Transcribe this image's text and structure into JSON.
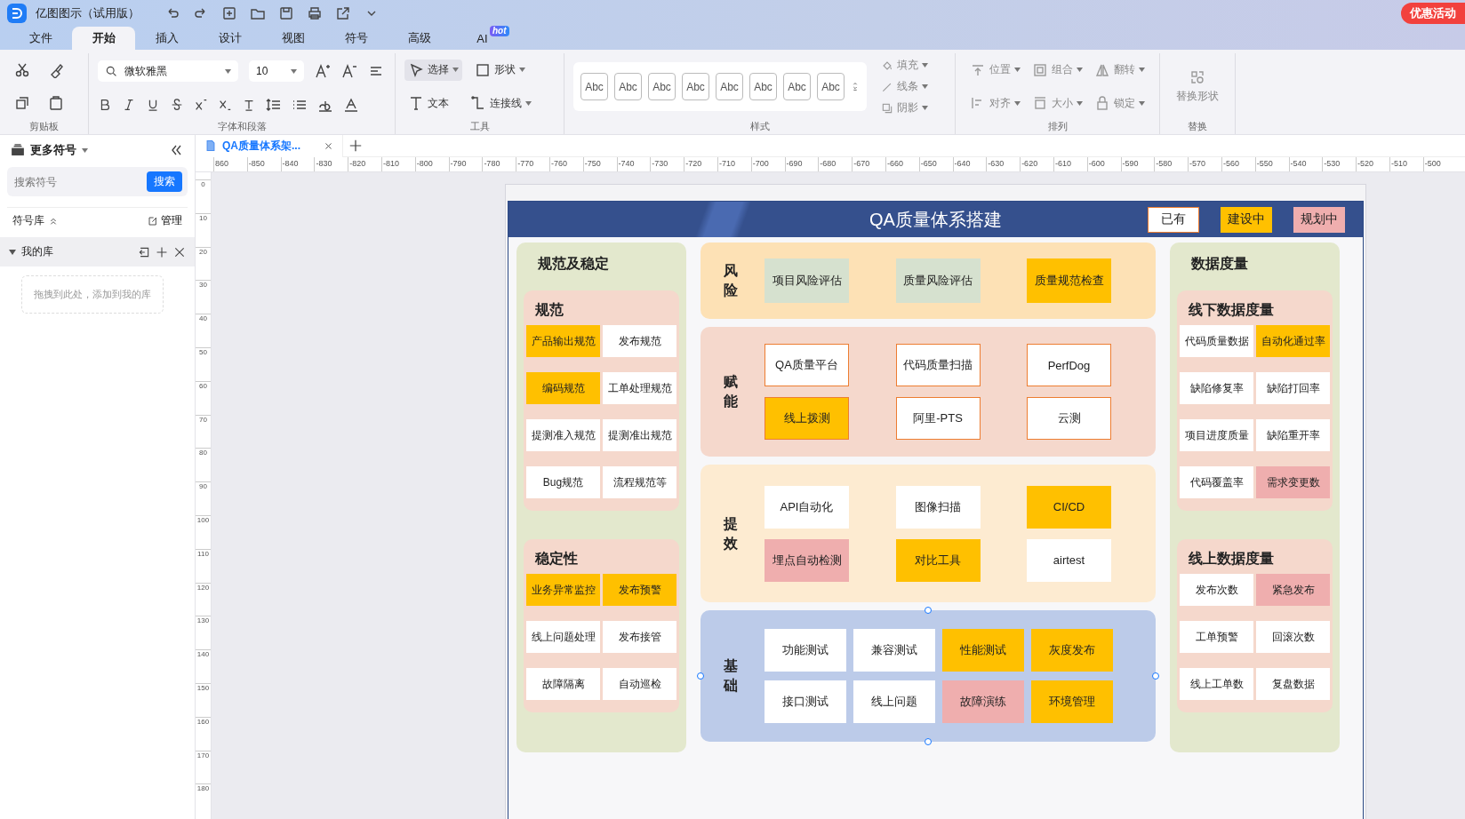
{
  "app": {
    "name": "亿图图示（试用版）",
    "promo": "优惠活动"
  },
  "menu_tabs": [
    {
      "label": "文件",
      "selected": false
    },
    {
      "label": "开始",
      "selected": true
    },
    {
      "label": "插入",
      "selected": false
    },
    {
      "label": "设计",
      "selected": false
    },
    {
      "label": "视图",
      "selected": false
    },
    {
      "label": "符号",
      "selected": false
    },
    {
      "label": "高级",
      "selected": false
    },
    {
      "label": "AI",
      "selected": false,
      "badge": "hot"
    }
  ],
  "ribbon": {
    "font": "微软雅黑",
    "font_size": "10",
    "tools": [
      "选择",
      "形状",
      "文本",
      "连接线"
    ],
    "styles": [
      "Abc",
      "Abc",
      "Abc",
      "Abc",
      "Abc",
      "Abc",
      "Abc",
      "Abc"
    ],
    "format": [
      "填充",
      "线条",
      "阴影"
    ],
    "arrange": [
      "位置",
      "组合",
      "翻转",
      "对齐",
      "大小",
      "锁定"
    ],
    "replace": "替换形状",
    "groups": [
      "剪贴板",
      "字体和段落",
      "工具",
      "样式",
      "排列",
      "替换"
    ]
  },
  "sidebar": {
    "title": "更多符号",
    "search_placeholder": "搜索符号",
    "search_button": "搜索",
    "library": "符号库",
    "manage": "管理",
    "my_library": "我的库",
    "drop_hint": "拖拽到此处，添加到我的库"
  },
  "doc_tab": {
    "title": "QA质量体系架..."
  },
  "ruler": {
    "horizontal": [
      "860",
      "-850",
      "-840",
      "-830",
      "-820",
      "-810",
      "-800",
      "-790",
      "-780",
      "-770",
      "-760",
      "-750",
      "-740",
      "-730",
      "-720",
      "-710",
      "-700",
      "-690",
      "-680",
      "-670",
      "-660",
      "-650",
      "-640",
      "-630",
      "-620",
      "-610",
      "-600",
      "-590",
      "-580",
      "-570",
      "-560",
      "-550",
      "-540",
      "-530",
      "-520",
      "-510",
      "-500"
    ],
    "vertical": [
      "0",
      "10",
      "20",
      "30",
      "40",
      "50",
      "60",
      "70",
      "80",
      "90",
      "100",
      "110",
      "120",
      "130",
      "140",
      "150",
      "160",
      "170",
      "180"
    ]
  },
  "diagram": {
    "title": "QA质量体系搭建",
    "legend": [
      {
        "label": "已有",
        "kind": "have"
      },
      {
        "label": "建设中",
        "kind": "building"
      },
      {
        "label": "规划中",
        "kind": "planning"
      }
    ],
    "left": {
      "title": "规范及稳定",
      "groups": [
        {
          "title": "规范",
          "items": [
            {
              "label": "产品输出规范",
              "kind": "building"
            },
            {
              "label": "发布规范",
              "kind": "have"
            },
            {
              "label": "编码规范",
              "kind": "building"
            },
            {
              "label": "工单处理规范",
              "kind": "have"
            },
            {
              "label": "提测准入规范",
              "kind": "have"
            },
            {
              "label": "提测准出规范",
              "kind": "have"
            },
            {
              "label": "Bug规范",
              "kind": "have"
            },
            {
              "label": "流程规范等",
              "kind": "have"
            }
          ]
        },
        {
          "title": "稳定性",
          "items": [
            {
              "label": "业务异常监控",
              "kind": "building"
            },
            {
              "label": "发布预警",
              "kind": "building"
            },
            {
              "label": "线上问题处理",
              "kind": "have"
            },
            {
              "label": "发布接管",
              "kind": "have"
            },
            {
              "label": "故障隔离",
              "kind": "have"
            },
            {
              "label": "自动巡检",
              "kind": "have"
            }
          ]
        }
      ]
    },
    "middle": [
      {
        "label": "风险",
        "kind": "risk",
        "selected": false,
        "items": [
          {
            "label": "项目风险评估",
            "kind": "neutral"
          },
          {
            "label": "质量风险评估",
            "kind": "neutral"
          },
          {
            "label": "质量规范检查",
            "kind": "building"
          }
        ]
      },
      {
        "label": "赋能",
        "kind": "enable",
        "selected": false,
        "items": [
          {
            "label": "QA质量平台",
            "kind": "have"
          },
          {
            "label": "代码质量扫描",
            "kind": "have"
          },
          {
            "label": "PerfDog",
            "kind": "have"
          },
          {
            "label": "线上拨测",
            "kind": "building"
          },
          {
            "label": "阿里-PTS",
            "kind": "have"
          },
          {
            "label": "云测",
            "kind": "have"
          }
        ]
      },
      {
        "label": "提效",
        "kind": "efficiency",
        "selected": false,
        "items": [
          {
            "label": "API自动化",
            "kind": "have"
          },
          {
            "label": "图像扫描",
            "kind": "have"
          },
          {
            "label": "CI/CD",
            "kind": "building"
          },
          {
            "label": "埋点自动检测",
            "kind": "planning"
          },
          {
            "label": "对比工具",
            "kind": "building"
          },
          {
            "label": "airtest",
            "kind": "have"
          }
        ]
      },
      {
        "label": "基础",
        "kind": "base",
        "selected": true,
        "items": [
          {
            "label": "功能测试",
            "kind": "have"
          },
          {
            "label": "兼容测试",
            "kind": "have"
          },
          {
            "label": "性能测试",
            "kind": "building"
          },
          {
            "label": "灰度发布",
            "kind": "building"
          },
          {
            "label": "接口测试",
            "kind": "have"
          },
          {
            "label": "线上问题",
            "kind": "have"
          },
          {
            "label": "故障演练",
            "kind": "planning"
          },
          {
            "label": "环境管理",
            "kind": "building"
          }
        ]
      }
    ],
    "right": {
      "title": "数据度量",
      "groups": [
        {
          "title": "线下数据度量",
          "items": [
            {
              "label": "代码质量数据",
              "kind": "have"
            },
            {
              "label": "自动化通过率",
              "kind": "building"
            },
            {
              "label": "缺陷修复率",
              "kind": "have"
            },
            {
              "label": "缺陷打回率",
              "kind": "have"
            },
            {
              "label": "项目进度质量",
              "kind": "have"
            },
            {
              "label": "缺陷重开率",
              "kind": "have"
            },
            {
              "label": "代码覆盖率",
              "kind": "have"
            },
            {
              "label": "需求变更数",
              "kind": "planning"
            }
          ]
        },
        {
          "title": "线上数据度量",
          "items": [
            {
              "label": "发布次数",
              "kind": "have"
            },
            {
              "label": "紧急发布",
              "kind": "planning"
            },
            {
              "label": "工单预警",
              "kind": "have"
            },
            {
              "label": "回滚次数",
              "kind": "have"
            },
            {
              "label": "线上工单数",
              "kind": "have"
            },
            {
              "label": "复盘数据",
              "kind": "have"
            }
          ]
        }
      ]
    }
  }
}
